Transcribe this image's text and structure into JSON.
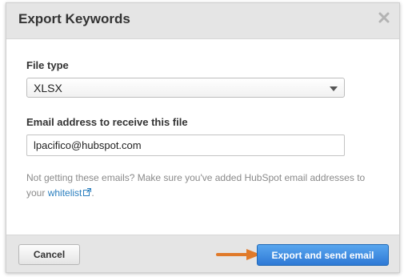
{
  "dialog": {
    "title": "Export Keywords"
  },
  "form": {
    "file_type": {
      "label": "File type",
      "selected": "XLSX"
    },
    "email": {
      "label": "Email address to receive this file",
      "value": "lpacifico@hubspot.com"
    },
    "help": {
      "text": "Not getting these emails? Make sure you've added HubSpot email addresses to your",
      "link_text": "whitelist",
      "end": "."
    }
  },
  "footer": {
    "cancel_label": "Cancel",
    "export_label": "Export and send email"
  },
  "colors": {
    "accent": "#3b82dc",
    "arrow": "#e07a2a",
    "link": "#2a7fbf"
  },
  "icons": [
    "close-icon",
    "chevron-down-icon",
    "external-link-icon",
    "arrow-annotation"
  ]
}
